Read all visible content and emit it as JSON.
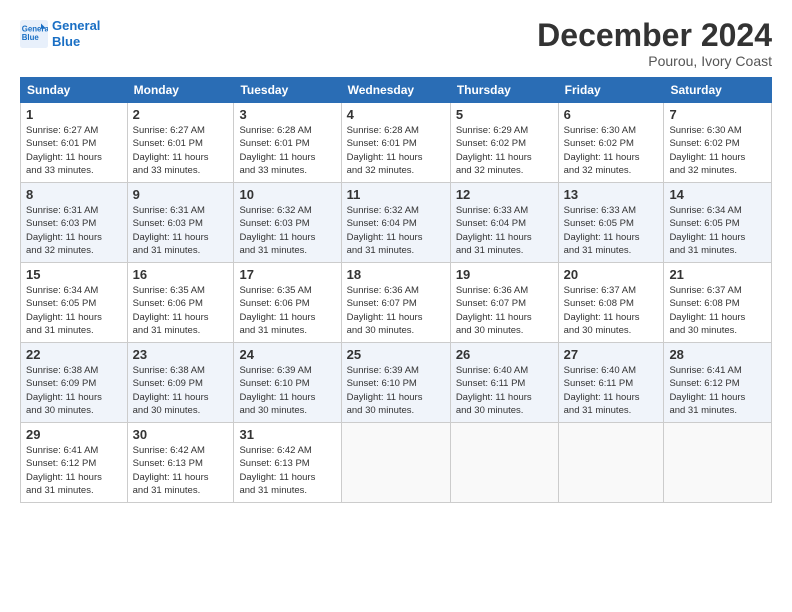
{
  "logo": {
    "line1": "General",
    "line2": "Blue"
  },
  "title": "December 2024",
  "location": "Pourou, Ivory Coast",
  "headers": [
    "Sunday",
    "Monday",
    "Tuesday",
    "Wednesday",
    "Thursday",
    "Friday",
    "Saturday"
  ],
  "weeks": [
    [
      {
        "day": "1",
        "info": "Sunrise: 6:27 AM\nSunset: 6:01 PM\nDaylight: 11 hours\nand 33 minutes."
      },
      {
        "day": "2",
        "info": "Sunrise: 6:27 AM\nSunset: 6:01 PM\nDaylight: 11 hours\nand 33 minutes."
      },
      {
        "day": "3",
        "info": "Sunrise: 6:28 AM\nSunset: 6:01 PM\nDaylight: 11 hours\nand 33 minutes."
      },
      {
        "day": "4",
        "info": "Sunrise: 6:28 AM\nSunset: 6:01 PM\nDaylight: 11 hours\nand 32 minutes."
      },
      {
        "day": "5",
        "info": "Sunrise: 6:29 AM\nSunset: 6:02 PM\nDaylight: 11 hours\nand 32 minutes."
      },
      {
        "day": "6",
        "info": "Sunrise: 6:30 AM\nSunset: 6:02 PM\nDaylight: 11 hours\nand 32 minutes."
      },
      {
        "day": "7",
        "info": "Sunrise: 6:30 AM\nSunset: 6:02 PM\nDaylight: 11 hours\nand 32 minutes."
      }
    ],
    [
      {
        "day": "8",
        "info": "Sunrise: 6:31 AM\nSunset: 6:03 PM\nDaylight: 11 hours\nand 32 minutes."
      },
      {
        "day": "9",
        "info": "Sunrise: 6:31 AM\nSunset: 6:03 PM\nDaylight: 11 hours\nand 31 minutes."
      },
      {
        "day": "10",
        "info": "Sunrise: 6:32 AM\nSunset: 6:03 PM\nDaylight: 11 hours\nand 31 minutes."
      },
      {
        "day": "11",
        "info": "Sunrise: 6:32 AM\nSunset: 6:04 PM\nDaylight: 11 hours\nand 31 minutes."
      },
      {
        "day": "12",
        "info": "Sunrise: 6:33 AM\nSunset: 6:04 PM\nDaylight: 11 hours\nand 31 minutes."
      },
      {
        "day": "13",
        "info": "Sunrise: 6:33 AM\nSunset: 6:05 PM\nDaylight: 11 hours\nand 31 minutes."
      },
      {
        "day": "14",
        "info": "Sunrise: 6:34 AM\nSunset: 6:05 PM\nDaylight: 11 hours\nand 31 minutes."
      }
    ],
    [
      {
        "day": "15",
        "info": "Sunrise: 6:34 AM\nSunset: 6:05 PM\nDaylight: 11 hours\nand 31 minutes."
      },
      {
        "day": "16",
        "info": "Sunrise: 6:35 AM\nSunset: 6:06 PM\nDaylight: 11 hours\nand 31 minutes."
      },
      {
        "day": "17",
        "info": "Sunrise: 6:35 AM\nSunset: 6:06 PM\nDaylight: 11 hours\nand 31 minutes."
      },
      {
        "day": "18",
        "info": "Sunrise: 6:36 AM\nSunset: 6:07 PM\nDaylight: 11 hours\nand 30 minutes."
      },
      {
        "day": "19",
        "info": "Sunrise: 6:36 AM\nSunset: 6:07 PM\nDaylight: 11 hours\nand 30 minutes."
      },
      {
        "day": "20",
        "info": "Sunrise: 6:37 AM\nSunset: 6:08 PM\nDaylight: 11 hours\nand 30 minutes."
      },
      {
        "day": "21",
        "info": "Sunrise: 6:37 AM\nSunset: 6:08 PM\nDaylight: 11 hours\nand 30 minutes."
      }
    ],
    [
      {
        "day": "22",
        "info": "Sunrise: 6:38 AM\nSunset: 6:09 PM\nDaylight: 11 hours\nand 30 minutes."
      },
      {
        "day": "23",
        "info": "Sunrise: 6:38 AM\nSunset: 6:09 PM\nDaylight: 11 hours\nand 30 minutes."
      },
      {
        "day": "24",
        "info": "Sunrise: 6:39 AM\nSunset: 6:10 PM\nDaylight: 11 hours\nand 30 minutes."
      },
      {
        "day": "25",
        "info": "Sunrise: 6:39 AM\nSunset: 6:10 PM\nDaylight: 11 hours\nand 30 minutes."
      },
      {
        "day": "26",
        "info": "Sunrise: 6:40 AM\nSunset: 6:11 PM\nDaylight: 11 hours\nand 30 minutes."
      },
      {
        "day": "27",
        "info": "Sunrise: 6:40 AM\nSunset: 6:11 PM\nDaylight: 11 hours\nand 31 minutes."
      },
      {
        "day": "28",
        "info": "Sunrise: 6:41 AM\nSunset: 6:12 PM\nDaylight: 11 hours\nand 31 minutes."
      }
    ],
    [
      {
        "day": "29",
        "info": "Sunrise: 6:41 AM\nSunset: 6:12 PM\nDaylight: 11 hours\nand 31 minutes."
      },
      {
        "day": "30",
        "info": "Sunrise: 6:42 AM\nSunset: 6:13 PM\nDaylight: 11 hours\nand 31 minutes."
      },
      {
        "day": "31",
        "info": "Sunrise: 6:42 AM\nSunset: 6:13 PM\nDaylight: 11 hours\nand 31 minutes."
      },
      null,
      null,
      null,
      null
    ]
  ]
}
